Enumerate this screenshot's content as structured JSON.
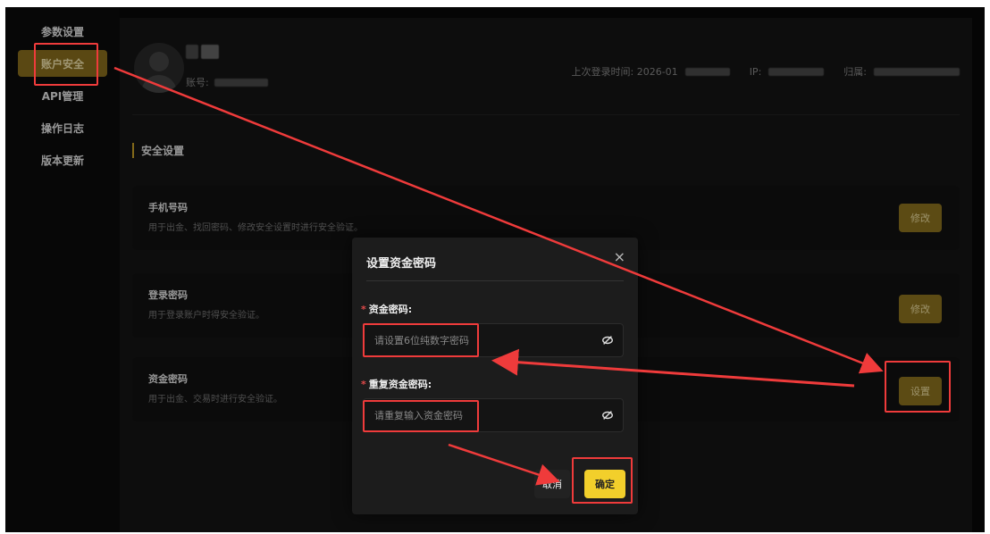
{
  "sidebar": {
    "items": [
      {
        "label": "参数设置"
      },
      {
        "label": "账户安全"
      },
      {
        "label": "API管理"
      },
      {
        "label": "操作日志"
      },
      {
        "label": "版本更新"
      }
    ]
  },
  "profile": {
    "username_visible": "",
    "account_label": "账号:",
    "last_login_label": "上次登录时间: 2026-01",
    "ip_label": "IP:",
    "location_label": "归属:"
  },
  "security": {
    "section_title": "安全设置",
    "items": [
      {
        "title": "手机号码",
        "desc": "用于出金、找回密码、修改安全设置时进行安全验证。",
        "button": "修改"
      },
      {
        "title": "登录密码",
        "desc": "用于登录账户时得安全验证。",
        "button": "修改"
      },
      {
        "title": "资金密码",
        "desc": "用于出金、交易时进行安全验证。",
        "button": "设置"
      }
    ]
  },
  "modal": {
    "title": "设置资金密码",
    "close": "×",
    "fund_password_label": "资金密码:",
    "fund_password_placeholder": "请设置6位纯数字密码",
    "repeat_label": "重复资金密码:",
    "repeat_placeholder": "请重复输入资金密码",
    "cancel": "取消",
    "confirm": "确定"
  },
  "colors": {
    "accent": "#8e7420",
    "confirm": "#f2cf2b",
    "highlight": "#ef3b3b"
  }
}
